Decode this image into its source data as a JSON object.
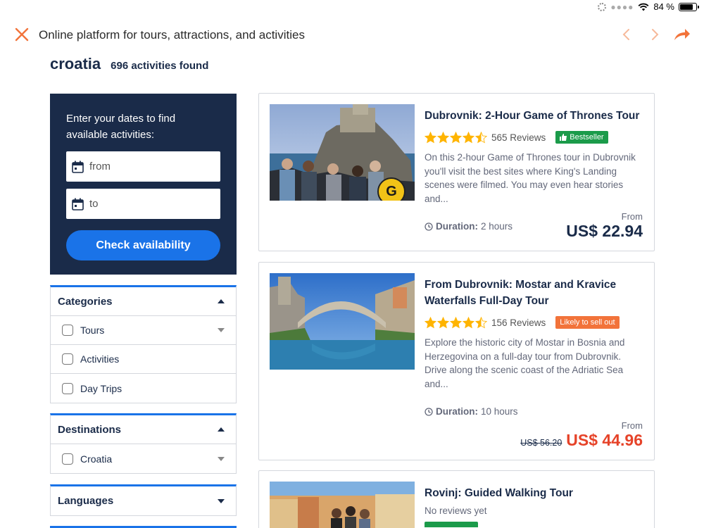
{
  "status": {
    "battery": "84 %",
    "battery_level": 0.84
  },
  "nav": {
    "title": "Online platform for tours, attractions, and activities",
    "accent": "#f2733a"
  },
  "search": {
    "query": "croatia",
    "results_count": "696 activities found"
  },
  "date_panel": {
    "prompt": "Enter your dates to find available activities:",
    "from_placeholder": "from",
    "to_placeholder": "to",
    "check_label": "Check availability"
  },
  "filters": {
    "categories": {
      "title": "Categories",
      "items": [
        "Tours",
        "Activities",
        "Day Trips"
      ]
    },
    "destinations": {
      "title": "Destinations",
      "items": [
        "Croatia"
      ]
    },
    "languages": {
      "title": "Languages"
    }
  },
  "activities": [
    {
      "title": "Dubrovnik: 2-Hour Game of Thrones Tour",
      "rating": 4.5,
      "reviews": "565 Reviews",
      "badge": "Bestseller",
      "badge_color": "#1b9b4a",
      "description": "On this 2-hour Game of Thrones tour in Dubrovnik you'll visit the best sites where King's Landing scenes were filmed. You may even hear stories and...",
      "duration_label": "Duration:",
      "duration": "2 hours",
      "price_from": "From",
      "price": "US$ 22.94",
      "image_badge": "G"
    },
    {
      "title": "From Dubrovnik: Mostar and Kravice Waterfalls Full-Day Tour",
      "rating": 4.5,
      "reviews": "156 Reviews",
      "badge": "Likely to sell out",
      "badge_color": "#f2733a",
      "description": "Explore the historic city of Mostar in Bosnia and Herzegovina on a full-day tour from Dubrovnik. Drive along the scenic coast of the Adriatic Sea and...",
      "duration_label": "Duration:",
      "duration": "10 hours",
      "price_from": "From",
      "old_price": "US$ 56.20",
      "price": "US$ 44.96"
    },
    {
      "title": "Rovinj: Guided Walking Tour",
      "reviews": "No reviews yet"
    }
  ]
}
